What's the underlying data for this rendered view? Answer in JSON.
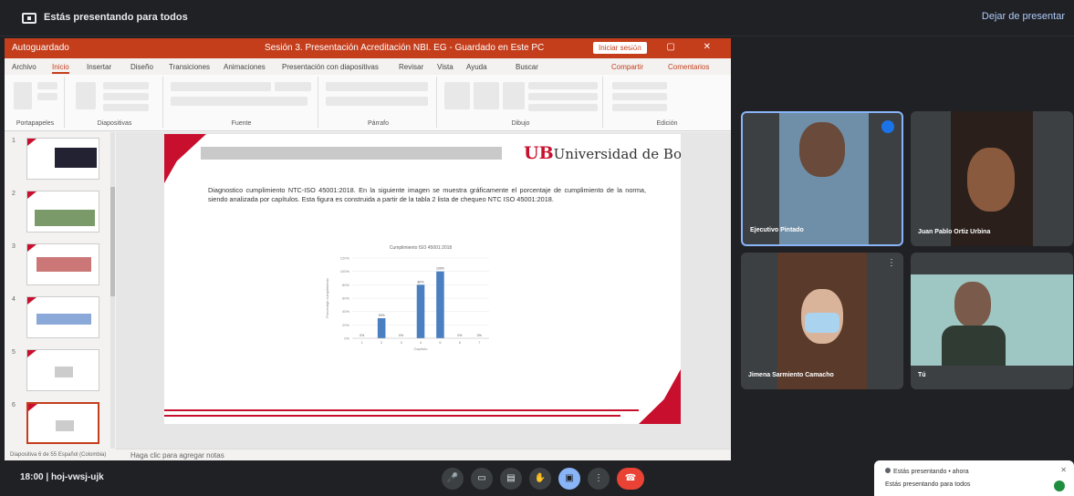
{
  "meet": {
    "presenting_title": "Estás presentando para todos",
    "stop_presenting": "Dejar de presentar",
    "clock": "18:00",
    "meeting_code": "hoj-vwsj-ujk"
  },
  "ppt": {
    "quick_access": "Autoguardado",
    "file_title": "Sesión 3. Presentación Acreditación NBI. EG - Guardado en Este PC",
    "signin_label": "Iniciar sesión",
    "window_controls": "— ▢ ✕",
    "tabs": [
      "Archivo",
      "Inicio",
      "Insertar",
      "Diseño",
      "Transiciones",
      "Animaciones",
      "Presentación con diapositivas",
      "Revisar",
      "Vista",
      "Ayuda",
      "Buscar"
    ],
    "share_label": "Compartir",
    "comments_label": "Comentarios",
    "groups": [
      "Portapapeles",
      "Diapositivas",
      "Fuente",
      "Párrafo",
      "Dibujo",
      "Edición"
    ],
    "notes_placeholder": "Haga clic para agregar notas",
    "status_text": "Diapositiva 6 de 55   Español (Colombia)",
    "thumb_numbers": [
      "1",
      "2",
      "3",
      "4",
      "5",
      "6"
    ]
  },
  "slide": {
    "logo_ub": "UB",
    "logo_text": "Universidad de Boyacá",
    "body": "Diagnostico cumplimiento NTC-ISO 45001:2018. En la siguiente imagen se muestra gráficamente el porcentaje de cumplimiento de la norma, siendo analizada por capítulos. Esta figura es construida a partir de la tabla 2 lista de chequeo NTC ISO 45001:2018."
  },
  "chart_data": {
    "type": "bar",
    "title": "Cumplimiento ISO 45001:2018",
    "xlabel": "Capítulo",
    "ylabel": "Porcentaje cumplimiento",
    "categories": [
      "1",
      "2",
      "3",
      "4",
      "5",
      "6",
      "7"
    ],
    "values": [
      0,
      30,
      0,
      80,
      100,
      0,
      0
    ],
    "ylim": [
      0,
      120
    ],
    "yticks": [
      "0%",
      "20%",
      "40%",
      "60%",
      "80%",
      "100%",
      "120%"
    ],
    "data_labels": [
      "0%",
      "30%",
      "0%",
      "80%",
      "100%",
      "0%",
      "0%"
    ],
    "bar_color": "#4a7fc1"
  },
  "participants": [
    {
      "name": "Ejecutivo Pintado",
      "active": true
    },
    {
      "name": "Juan Pablo Ortiz Urbina",
      "active": false
    },
    {
      "name": "Jimena Sarmiento Camacho",
      "active": false
    },
    {
      "name": "Tú",
      "active": false
    }
  ],
  "controls": [
    "mic-icon",
    "camera-icon",
    "captions-icon",
    "raise-hand-icon",
    "present-icon",
    "more-icon",
    "hangup-icon"
  ],
  "toast": {
    "title": "Estás presentando • ahora",
    "text": "Estás presentando para todos"
  }
}
